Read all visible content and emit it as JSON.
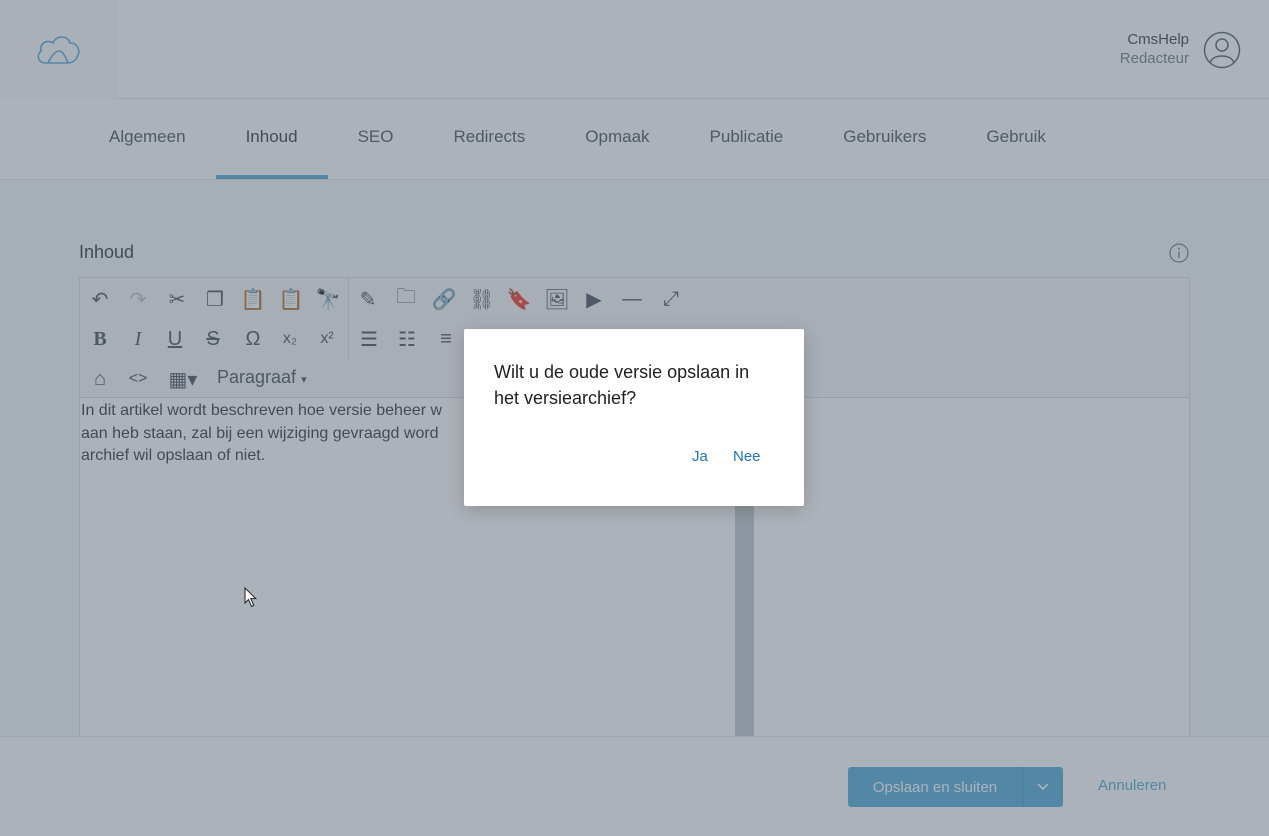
{
  "header": {
    "logo_icon": "cloud-logo-icon",
    "user_name": "CmsHelp",
    "user_role": "Redacteur",
    "avatar_icon": "user-avatar-icon"
  },
  "tabs": [
    {
      "label": "Algemeen",
      "active": false
    },
    {
      "label": "Inhoud",
      "active": true
    },
    {
      "label": "SEO",
      "active": false
    },
    {
      "label": "Redirects",
      "active": false
    },
    {
      "label": "Opmaak",
      "active": false
    },
    {
      "label": "Publicatie",
      "active": false
    },
    {
      "label": "Gebruikers",
      "active": false
    },
    {
      "label": "Gebruik",
      "active": false
    }
  ],
  "section": {
    "title": "Inhoud"
  },
  "editor": {
    "format_label": "Paragraaf",
    "text": "In dit artikel wordt beschreven hoe versie beheer w\naan heb staan, zal bij een wijziging gevraagd word\narchief wil opslaan of niet."
  },
  "footer": {
    "save_label": "Opslaan en sluiten",
    "cancel_label": "Annuleren"
  },
  "dialog": {
    "message": "Wilt u de oude versie opslaan in het versiearchief?",
    "yes_label": "Ja",
    "no_label": "Nee"
  },
  "colors": {
    "accent": "#5bb3dd",
    "link": "#1a73c8",
    "overlay": "#465464"
  }
}
